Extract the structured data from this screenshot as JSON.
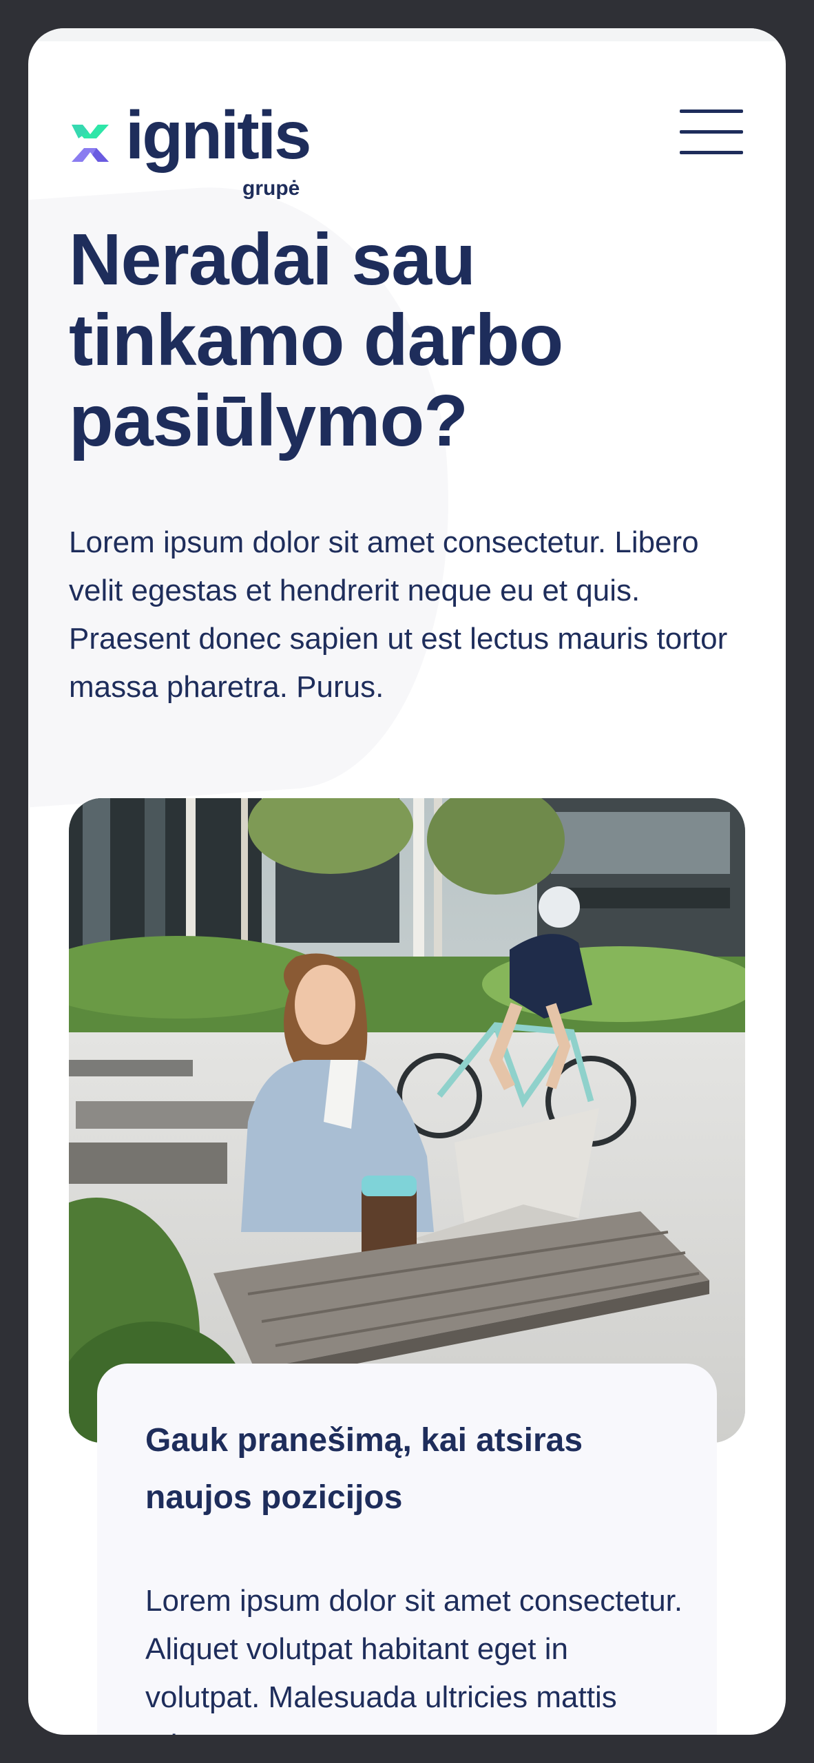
{
  "header": {
    "logo_word": "ignitis",
    "logo_sub": "grupė",
    "menu_icon": "hamburger-menu-icon"
  },
  "hero": {
    "title": "Neradai sau tinkamo darbo pasiūlymo?",
    "text": "Lorem ipsum dolor sit amet consectetur. Libero velit egestas et hendrerit neque eu et quis. Praesent donec sapien ut est lectus mauris tortor massa pharetra. Purus."
  },
  "image": {
    "subject": "woman working on laptop at outdoor table with cyclist in background"
  },
  "card": {
    "title": "Gauk pranešimą, kai atsiras naujos pozicijos",
    "text": "Lorem ipsum dolor sit amet consectetur. Aliquet volutpat habitant eget in volutpat. Malesuada ultricies mattis etiam egestas et"
  },
  "colors": {
    "brand_navy": "#1e2d5b",
    "logo_green": "#2ee6a8",
    "logo_purple": "#8a7cf0",
    "card_bg": "#f8f8fc",
    "frame": "#2f3036"
  }
}
